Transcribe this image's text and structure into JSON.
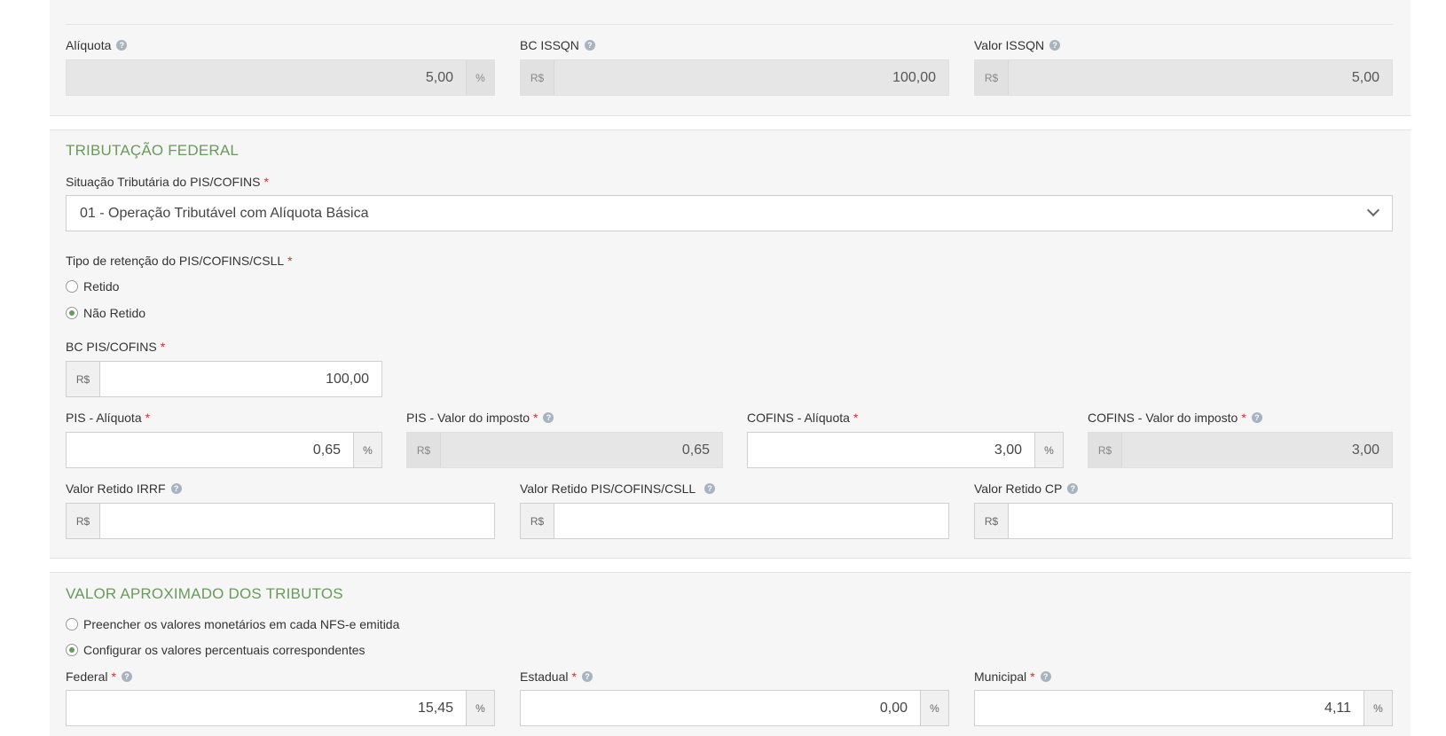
{
  "iss": {
    "aliquota_label": "Alíquota",
    "aliquota_value": "5,00",
    "aliquota_unit": "%",
    "bc_label": "BC ISSQN",
    "bc_prefix": "R$",
    "bc_value": "100,00",
    "valor_label": "Valor ISSQN",
    "valor_prefix": "R$",
    "valor_value": "5,00"
  },
  "federal": {
    "title": "TRIBUTAÇÃO FEDERAL",
    "situacao_label": "Situação Tributária do PIS/COFINS",
    "situacao_selected": "01 - Operação Tributável com Alíquota Básica",
    "retencao_label": "Tipo de retenção do PIS/COFINS/CSLL",
    "retencao_options": [
      {
        "label": "Retido",
        "checked": false
      },
      {
        "label": "Não Retido",
        "checked": true
      }
    ],
    "bc_label": "BC PIS/COFINS",
    "bc_prefix": "R$",
    "bc_value": "100,00",
    "pis_aliquota_label": "PIS - Alíquota",
    "pis_aliquota_value": "0,65",
    "pis_aliquota_unit": "%",
    "pis_valor_label": "PIS - Valor do imposto",
    "pis_valor_prefix": "R$",
    "pis_valor_value": "0,65",
    "cofins_aliquota_label": "COFINS - Alíquota",
    "cofins_aliquota_value": "3,00",
    "cofins_aliquota_unit": "%",
    "cofins_valor_label": "COFINS - Valor do imposto",
    "cofins_valor_prefix": "R$",
    "cofins_valor_value": "3,00",
    "irrf_label": "Valor Retido IRRF",
    "irrf_prefix": "R$",
    "irrf_value": "",
    "pcc_label": "Valor Retido PIS/COFINS/CSLL",
    "pcc_prefix": "R$",
    "pcc_value": "",
    "cp_label": "Valor Retido CP",
    "cp_prefix": "R$",
    "cp_value": ""
  },
  "tributos": {
    "title": "VALOR APROXIMADO DOS TRIBUTOS",
    "options": [
      {
        "label": "Preencher os valores monetários em cada NFS-e emitida",
        "checked": false
      },
      {
        "label": "Configurar os valores percentuais correspondentes",
        "checked": true
      }
    ],
    "federal_label": "Federal",
    "federal_value": "15,45",
    "estadual_label": "Estadual",
    "estadual_value": "0,00",
    "municipal_label": "Municipal",
    "municipal_value": "4,11",
    "unit": "%"
  },
  "common": {
    "required_mark": "*",
    "help_glyph": "?"
  },
  "colors": {
    "section_title": "#6a9a5b",
    "required": "#c0392b",
    "panel_bg": "#f6f6f6",
    "readonly_bg": "#e6e6e6"
  }
}
